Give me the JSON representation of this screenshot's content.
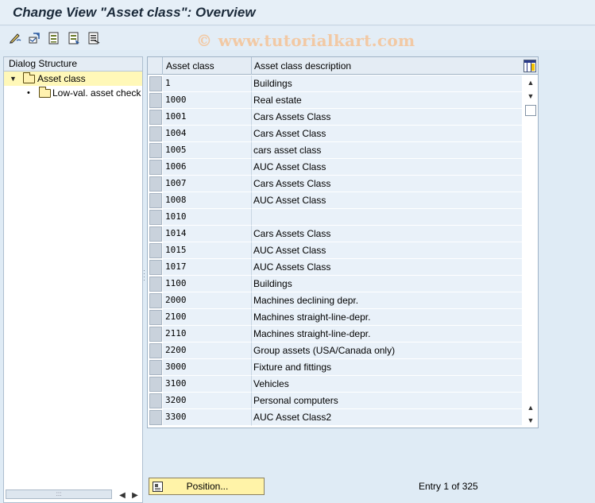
{
  "window": {
    "title": "Change View \"Asset class\": Overview"
  },
  "watermark": "© www.tutorialkart.com",
  "toolbar": {
    "buttons": [
      {
        "icon": "edit-pencil-icon"
      },
      {
        "icon": "other-view-icon"
      },
      {
        "icon": "save-list-icon"
      },
      {
        "icon": "copy-as-icon"
      },
      {
        "icon": "select-all-icon"
      }
    ]
  },
  "dialog_structure": {
    "header": "Dialog Structure",
    "items": [
      {
        "label": "Asset class",
        "level": 0,
        "expanded": true,
        "selected": true
      },
      {
        "label": "Low-val. asset check",
        "level": 1,
        "expanded": false,
        "selected": false
      }
    ]
  },
  "table": {
    "columns": [
      "Asset class",
      "Asset class description"
    ],
    "rows": [
      {
        "asset_class": "1",
        "description": "Buildings"
      },
      {
        "asset_class": "1000",
        "description": "Real estate"
      },
      {
        "asset_class": "1001",
        "description": "Cars Assets Class"
      },
      {
        "asset_class": "1004",
        "description": "Cars Asset Class"
      },
      {
        "asset_class": "1005",
        "description": "cars asset class"
      },
      {
        "asset_class": "1006",
        "description": "AUC Asset Class"
      },
      {
        "asset_class": "1007",
        "description": "Cars Assets Class"
      },
      {
        "asset_class": "1008",
        "description": "AUC Asset Class"
      },
      {
        "asset_class": "1010",
        "description": ""
      },
      {
        "asset_class": "1014",
        "description": "Cars Assets Class"
      },
      {
        "asset_class": "1015",
        "description": "AUC Asset Class"
      },
      {
        "asset_class": "1017",
        "description": "AUC Assets Class"
      },
      {
        "asset_class": "1100",
        "description": "Buildings"
      },
      {
        "asset_class": "2000",
        "description": "Machines declining depr."
      },
      {
        "asset_class": "2100",
        "description": "Machines straight-line-depr."
      },
      {
        "asset_class": "2110",
        "description": "Machines straight-line-depr."
      },
      {
        "asset_class": "2200",
        "description": "Group assets (USA/Canada only)"
      },
      {
        "asset_class": "3000",
        "description": "Fixture and fittings"
      },
      {
        "asset_class": "3100",
        "description": "Vehicles"
      },
      {
        "asset_class": "3200",
        "description": "Personal computers"
      },
      {
        "asset_class": "3300",
        "description": "AUC Asset Class2"
      }
    ]
  },
  "footer": {
    "position_label": "Position...",
    "entry_text": "Entry 1 of 325"
  },
  "colors": {
    "background": "#dfebf5",
    "row_bg": "#e9f1f9",
    "selected_tree_bg": "#fff8b8",
    "button_bg": "#fff3a8",
    "watermark": "#f2c9a4"
  }
}
